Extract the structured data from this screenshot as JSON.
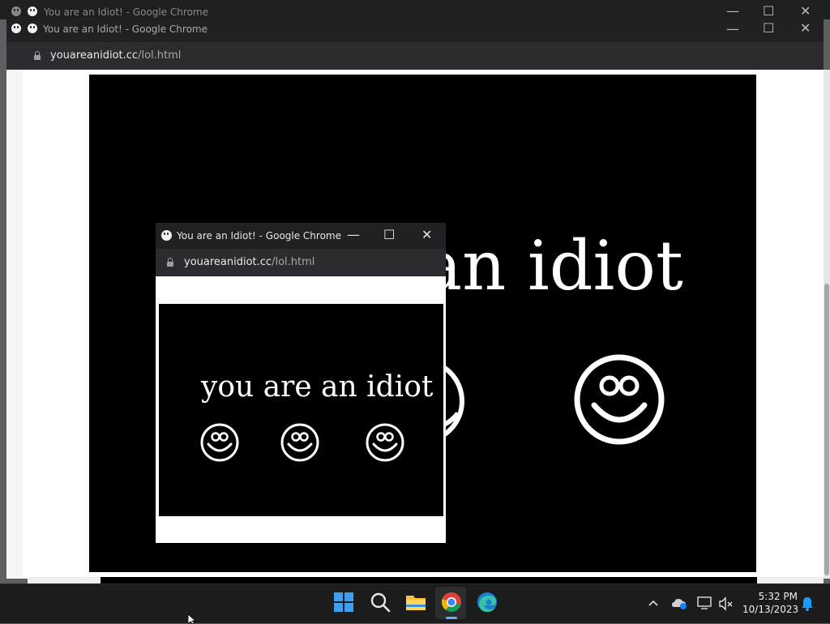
{
  "back_window": {
    "title": "You are an Idiot! - Google Chrome"
  },
  "main_window": {
    "title": "You are an Idiot! - Google Chrome",
    "url_domain": "youareanidiot.cc",
    "url_path": "/lol.html",
    "page_text": "an idiot"
  },
  "popup_window": {
    "title": "You are an Idiot! - Google Chrome",
    "url_domain": "youareanidiot.cc",
    "url_path": "/lol.html",
    "page_text": "you are an idiot"
  },
  "taskbar": {
    "time": "5:32 PM",
    "date": "10/13/2023",
    "apps": [
      "start-icon",
      "search-icon",
      "file-explorer-icon",
      "chrome-icon",
      "edge-icon"
    ]
  },
  "colors": {
    "titlebar": "#202124",
    "taskbar": "#1c1c1c",
    "page_black": "#000000",
    "page_white": "#ffffff",
    "accent": "#0078d4"
  }
}
